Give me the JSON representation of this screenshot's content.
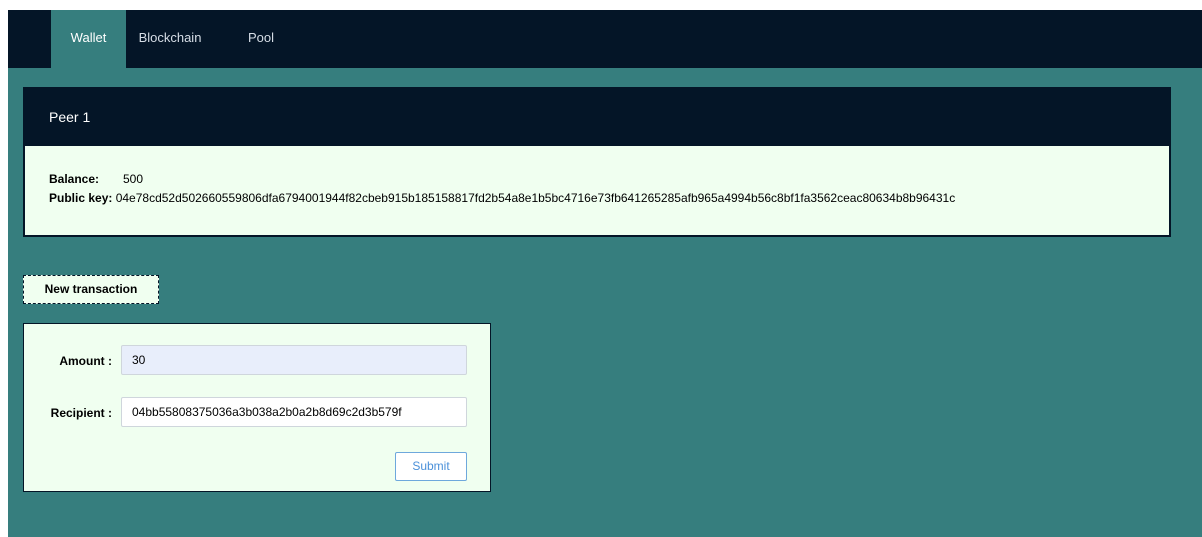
{
  "nav": {
    "tabs": [
      {
        "label": "Wallet",
        "active": true
      },
      {
        "label": "Blockchain",
        "active": false
      },
      {
        "label": "Pool",
        "active": false
      }
    ]
  },
  "peer": {
    "title": "Peer 1",
    "balance_label": "Balance:",
    "balance_value": "500",
    "public_key_label": "Public key:",
    "public_key_value": "04e78cd52d502660559806dfa6794001944f82cbeb915b185158817fd2b54a8e1b5bc4716e73fb641265285afb965a4994b56c8bf1fa3562ceac80634b8b96431c"
  },
  "new_transaction": {
    "button_label": "New transaction"
  },
  "form": {
    "amount_label": "Amount :",
    "amount_value": "30",
    "recipient_label": "Recipient :",
    "recipient_value": "04bb55808375036a3b038a2b0a2b8d69c2d3b579f",
    "submit_label": "Submit"
  },
  "colors": {
    "navbar": "#041527",
    "background": "#367e7e",
    "card": "#f0fff0",
    "submit_accent": "#4a90d9"
  }
}
